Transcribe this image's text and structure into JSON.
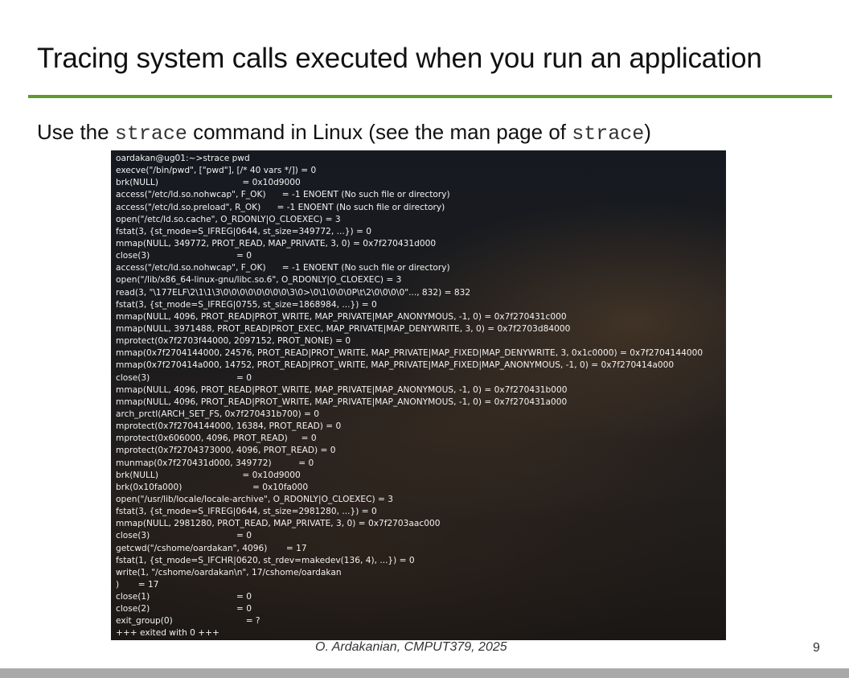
{
  "slide": {
    "title": "Tracing system calls executed when you run an application",
    "subtitle_prefix": "Use the ",
    "subtitle_cmd1": "strace",
    "subtitle_middle": " command in Linux (see the man page of ",
    "subtitle_cmd2": "strace",
    "subtitle_suffix": ")",
    "footer_credit": "O. Ardakanian, CMPUT379, 2025",
    "page_number": "9",
    "accent_color": "#5c9b2c"
  },
  "terminal": {
    "lines": [
      "oardakan@ug01:~>strace pwd",
      "execve(\"/bin/pwd\", [\"pwd\"], [/* 40 vars */]) = 0",
      "brk(NULL)                               = 0x10d9000",
      "access(\"/etc/ld.so.nohwcap\", F_OK)      = -1 ENOENT (No such file or directory)",
      "access(\"/etc/ld.so.preload\", R_OK)      = -1 ENOENT (No such file or directory)",
      "open(\"/etc/ld.so.cache\", O_RDONLY|O_CLOEXEC) = 3",
      "fstat(3, {st_mode=S_IFREG|0644, st_size=349772, ...}) = 0",
      "mmap(NULL, 349772, PROT_READ, MAP_PRIVATE, 3, 0) = 0x7f270431d000",
      "close(3)                                = 0",
      "access(\"/etc/ld.so.nohwcap\", F_OK)      = -1 ENOENT (No such file or directory)",
      "open(\"/lib/x86_64-linux-gnu/libc.so.6\", O_RDONLY|O_CLOEXEC) = 3",
      "read(3, \"\\177ELF\\2\\1\\1\\3\\0\\0\\0\\0\\0\\0\\0\\0\\3\\0>\\0\\1\\0\\0\\0P\\t\\2\\0\\0\\0\\0\"..., 832) = 832",
      "fstat(3, {st_mode=S_IFREG|0755, st_size=1868984, ...}) = 0",
      "mmap(NULL, 4096, PROT_READ|PROT_WRITE, MAP_PRIVATE|MAP_ANONYMOUS, -1, 0) = 0x7f270431c000",
      "mmap(NULL, 3971488, PROT_READ|PROT_EXEC, MAP_PRIVATE|MAP_DENYWRITE, 3, 0) = 0x7f2703d84000",
      "mprotect(0x7f2703f44000, 2097152, PROT_NONE) = 0",
      "mmap(0x7f2704144000, 24576, PROT_READ|PROT_WRITE, MAP_PRIVATE|MAP_FIXED|MAP_DENYWRITE, 3, 0x1c0000) = 0x7f2704144000",
      "mmap(0x7f270414a000, 14752, PROT_READ|PROT_WRITE, MAP_PRIVATE|MAP_FIXED|MAP_ANONYMOUS, -1, 0) = 0x7f270414a000",
      "close(3)                                = 0",
      "mmap(NULL, 4096, PROT_READ|PROT_WRITE, MAP_PRIVATE|MAP_ANONYMOUS, -1, 0) = 0x7f270431b000",
      "mmap(NULL, 4096, PROT_READ|PROT_WRITE, MAP_PRIVATE|MAP_ANONYMOUS, -1, 0) = 0x7f270431a000",
      "arch_prctl(ARCH_SET_FS, 0x7f270431b700) = 0",
      "mprotect(0x7f2704144000, 16384, PROT_READ) = 0",
      "mprotect(0x606000, 4096, PROT_READ)     = 0",
      "mprotect(0x7f2704373000, 4096, PROT_READ) = 0",
      "munmap(0x7f270431d000, 349772)          = 0",
      "brk(NULL)                               = 0x10d9000",
      "brk(0x10fa000)                          = 0x10fa000",
      "open(\"/usr/lib/locale/locale-archive\", O_RDONLY|O_CLOEXEC) = 3",
      "fstat(3, {st_mode=S_IFREG|0644, st_size=2981280, ...}) = 0",
      "mmap(NULL, 2981280, PROT_READ, MAP_PRIVATE, 3, 0) = 0x7f2703aac000",
      "close(3)                                = 0",
      "getcwd(\"/cshome/oardakan\", 4096)       = 17",
      "fstat(1, {st_mode=S_IFCHR|0620, st_rdev=makedev(136, 4), ...}) = 0",
      "write(1, \"/cshome/oardakan\\n\", 17/cshome/oardakan",
      ")       = 17",
      "close(1)                                = 0",
      "close(2)                                = 0",
      "exit_group(0)                           = ?",
      "+++ exited with 0 +++"
    ]
  }
}
